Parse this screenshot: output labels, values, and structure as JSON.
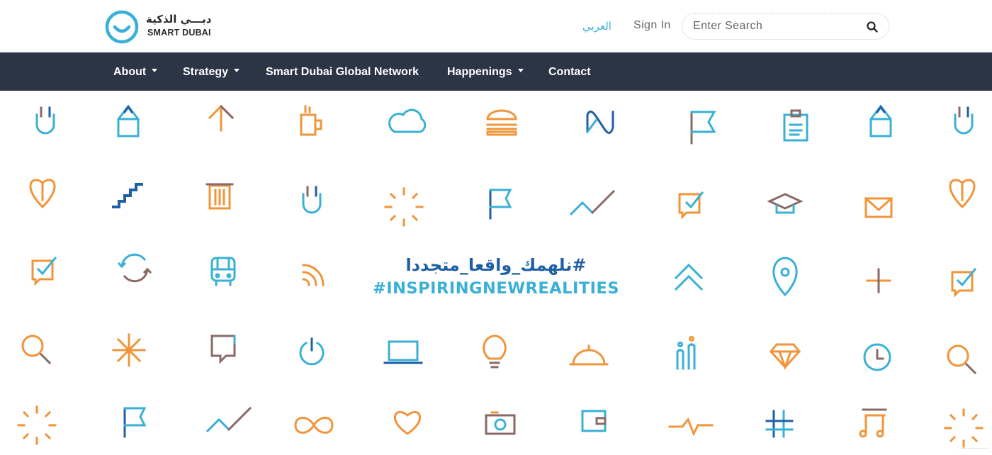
{
  "header": {
    "logo_arabic": "دبـــي الذكية",
    "logo_english": "SMART DUBAI",
    "language_link": "العربي",
    "sign_in": "Sign In",
    "search_placeholder": "Enter Search"
  },
  "nav": {
    "items": [
      {
        "label": "About",
        "has_dropdown": true
      },
      {
        "label": "Strategy",
        "has_dropdown": true
      },
      {
        "label": "Smart Dubai Global Network",
        "has_dropdown": false
      },
      {
        "label": "Happenings",
        "has_dropdown": true
      },
      {
        "label": "Contact",
        "has_dropdown": false
      }
    ]
  },
  "hero": {
    "hashtag_arabic": "#نلهمك_واقعا_متجددا",
    "hashtag_english": "#INSPIRINGNEWREALITIES",
    "icons": [
      [
        "plug-icon",
        "pencil-icon",
        "arrow-up-icon",
        "mug-icon",
        "cloud-icon",
        "burger-icon",
        "infinity-wave-icon",
        "flag-icon",
        "clipboard-icon",
        "pencil-icon",
        "plug-icon"
      ],
      [
        "location-petal-icon",
        "stairs-icon",
        "trash-icon",
        "plug-icon",
        "sunburst-icon",
        "flag-icon",
        "trend-line-icon",
        "checkbox-icon",
        "graduation-cap-icon",
        "envelope-icon",
        "location-petal-icon"
      ],
      [
        "checkbox-icon",
        "refresh-icon",
        "bus-icon",
        "rss-icon",
        "chevrons-up-icon",
        "location-pin-icon",
        "plus-icon",
        "checkbox-icon"
      ],
      [
        "search-icon",
        "asterisk-icon",
        "chat-bubble-icon",
        "power-icon",
        "laptop-icon",
        "lightbulb-icon",
        "cloche-icon",
        "people-icon",
        "diamond-icon",
        "clock-icon",
        "search-icon"
      ],
      [
        "sunburst-icon",
        "flag-icon",
        "trend-line-icon",
        "infinity-icon",
        "heart-icon",
        "camera-icon",
        "wallet-icon",
        "pulse-icon",
        "hashtag-grid-icon",
        "music-note-icon",
        "sunburst-icon"
      ]
    ]
  },
  "colors": {
    "nav_background": "#2c3545",
    "brand_blue": "#3ab0d6",
    "dark_blue": "#1f5fa6",
    "orange": "#f0953a",
    "gray_brown": "#8a6a66"
  }
}
